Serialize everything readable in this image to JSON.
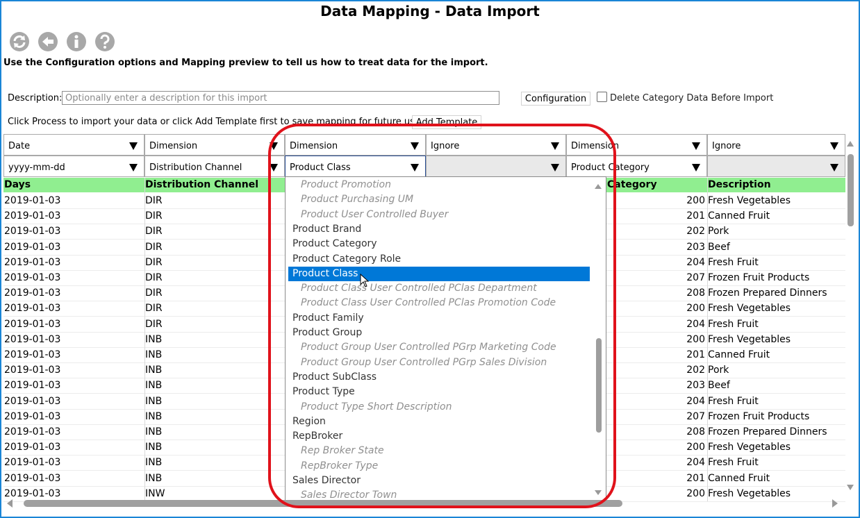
{
  "title": "Data Mapping - Data Import",
  "toolbar": {
    "icons": [
      "refresh-icon",
      "back-icon",
      "info-icon",
      "help-icon"
    ]
  },
  "instructions": "Use the Configuration options and Mapping preview to tell us how to treat data for the import.",
  "description": {
    "label": "Description:",
    "placeholder": "Optionally enter a description for this import",
    "value": ""
  },
  "configuration_label": "Configuration",
  "delete_category": {
    "label": "Delete Category Data Before Import",
    "checked": false
  },
  "process_text": "Click Process to import your data or click Add Template first to save mapping for future use.",
  "add_template_label": "Add Template",
  "columns": [
    {
      "type": "Date",
      "format": "yyyy-mm-dd",
      "header": "Days"
    },
    {
      "type": "Dimension",
      "format": "Distribution Channel",
      "header": "Distribution Channel"
    },
    {
      "type": "Dimension",
      "format": "Product Class",
      "header": ""
    },
    {
      "type": "Ignore",
      "format": "",
      "header": ""
    },
    {
      "type": "Dimension",
      "format": "Product Category",
      "header": "Category"
    },
    {
      "type": "Ignore",
      "format": "",
      "header": "Description"
    }
  ],
  "rows": [
    [
      "2019-01-03",
      "DIR",
      "200",
      "Fresh Vegetables"
    ],
    [
      "2019-01-03",
      "DIR",
      "201",
      "Canned Fruit"
    ],
    [
      "2019-01-03",
      "DIR",
      "202",
      "Pork"
    ],
    [
      "2019-01-03",
      "DIR",
      "203",
      "Beef"
    ],
    [
      "2019-01-03",
      "DIR",
      "204",
      "Fresh Fruit"
    ],
    [
      "2019-01-03",
      "DIR",
      "207",
      "Frozen Fruit Products"
    ],
    [
      "2019-01-03",
      "DIR",
      "208",
      "Frozen Prepared Dinners"
    ],
    [
      "2019-01-03",
      "DIR",
      "200",
      "Fresh Vegetables"
    ],
    [
      "2019-01-03",
      "DIR",
      "204",
      "Fresh Fruit"
    ],
    [
      "2019-01-03",
      "INB",
      "200",
      "Fresh Vegetables"
    ],
    [
      "2019-01-03",
      "INB",
      "201",
      "Canned Fruit"
    ],
    [
      "2019-01-03",
      "INB",
      "202",
      "Pork"
    ],
    [
      "2019-01-03",
      "INB",
      "203",
      "Beef"
    ],
    [
      "2019-01-03",
      "INB",
      "204",
      "Fresh Fruit"
    ],
    [
      "2019-01-03",
      "INB",
      "207",
      "Frozen Fruit Products"
    ],
    [
      "2019-01-03",
      "INB",
      "208",
      "Frozen Prepared Dinners"
    ],
    [
      "2019-01-03",
      "INB",
      "200",
      "Fresh Vegetables"
    ],
    [
      "2019-01-03",
      "INB",
      "204",
      "Fresh Fruit"
    ],
    [
      "2019-01-03",
      "INB",
      "201",
      "Canned Fruit"
    ],
    [
      "2019-01-03",
      "INW",
      "200",
      "Fresh Vegetables"
    ]
  ],
  "dropdown": {
    "selected": "Product Class",
    "options": [
      {
        "label": "Product Promotion",
        "sub": true
      },
      {
        "label": "Product Purchasing UM",
        "sub": true
      },
      {
        "label": "Product User Controlled Buyer",
        "sub": true
      },
      {
        "label": "Product Brand",
        "sub": false
      },
      {
        "label": "Product Category",
        "sub": false
      },
      {
        "label": "Product Category Role",
        "sub": false
      },
      {
        "label": "Product Class",
        "sub": false
      },
      {
        "label": "Product Class User Controlled PClas Department",
        "sub": true
      },
      {
        "label": "Product Class User Controlled PClas Promotion Code",
        "sub": true
      },
      {
        "label": "Product Family",
        "sub": false
      },
      {
        "label": "Product Group",
        "sub": false
      },
      {
        "label": "Product Group User Controlled PGrp Marketing Code",
        "sub": true
      },
      {
        "label": "Product Group User Controlled PGrp Sales Division",
        "sub": true
      },
      {
        "label": "Product SubClass",
        "sub": false
      },
      {
        "label": "Product Type",
        "sub": false
      },
      {
        "label": "Product Type Short Description",
        "sub": true
      },
      {
        "label": "Region",
        "sub": false
      },
      {
        "label": "RepBroker",
        "sub": false
      },
      {
        "label": "Rep Broker State",
        "sub": true
      },
      {
        "label": "RepBroker Type",
        "sub": true
      },
      {
        "label": "Sales Director",
        "sub": false
      },
      {
        "label": "Sales Director Town",
        "sub": true
      }
    ]
  },
  "colors": {
    "header_bg": "#90ee90",
    "selected_bg": "#0078d7",
    "highlight": "#e0121b",
    "frame": "#1a85d6"
  }
}
